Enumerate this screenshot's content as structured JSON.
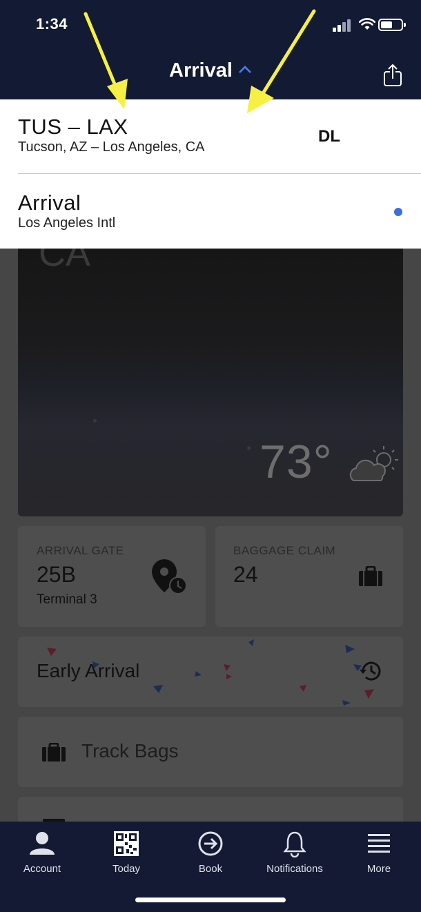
{
  "status_bar": {
    "time": "1:34"
  },
  "header": {
    "title": "Arrival"
  },
  "dropdown": {
    "route": {
      "code": "TUS – LAX",
      "cities": "Tucson, AZ – Los Angeles, CA",
      "carrier": "DL"
    },
    "arrival_option": {
      "label": "Arrival",
      "airport": "Los Angeles Intl"
    }
  },
  "hero": {
    "city_fragment": "CA",
    "temperature": "73°"
  },
  "cards": {
    "arrival_gate": {
      "label": "ARRIVAL GATE",
      "value": "25B",
      "terminal": "Terminal 3"
    },
    "baggage_claim": {
      "label": "BAGGAGE CLAIM",
      "value": "24"
    },
    "early_arrival": {
      "label": "Early Arrival"
    },
    "track_bags": {
      "label": "Track Bags"
    }
  },
  "tabbar": {
    "items": [
      {
        "label": "Account",
        "icon": "person-icon"
      },
      {
        "label": "Today",
        "icon": "qr-code-icon"
      },
      {
        "label": "Book",
        "icon": "arrow-circle-icon"
      },
      {
        "label": "Notifications",
        "icon": "bell-icon"
      },
      {
        "label": "More",
        "icon": "menu-icon"
      }
    ]
  },
  "colors": {
    "navy": "#131a33",
    "accent_blue": "#3c6ee0",
    "annotation_yellow": "#f5f043"
  }
}
